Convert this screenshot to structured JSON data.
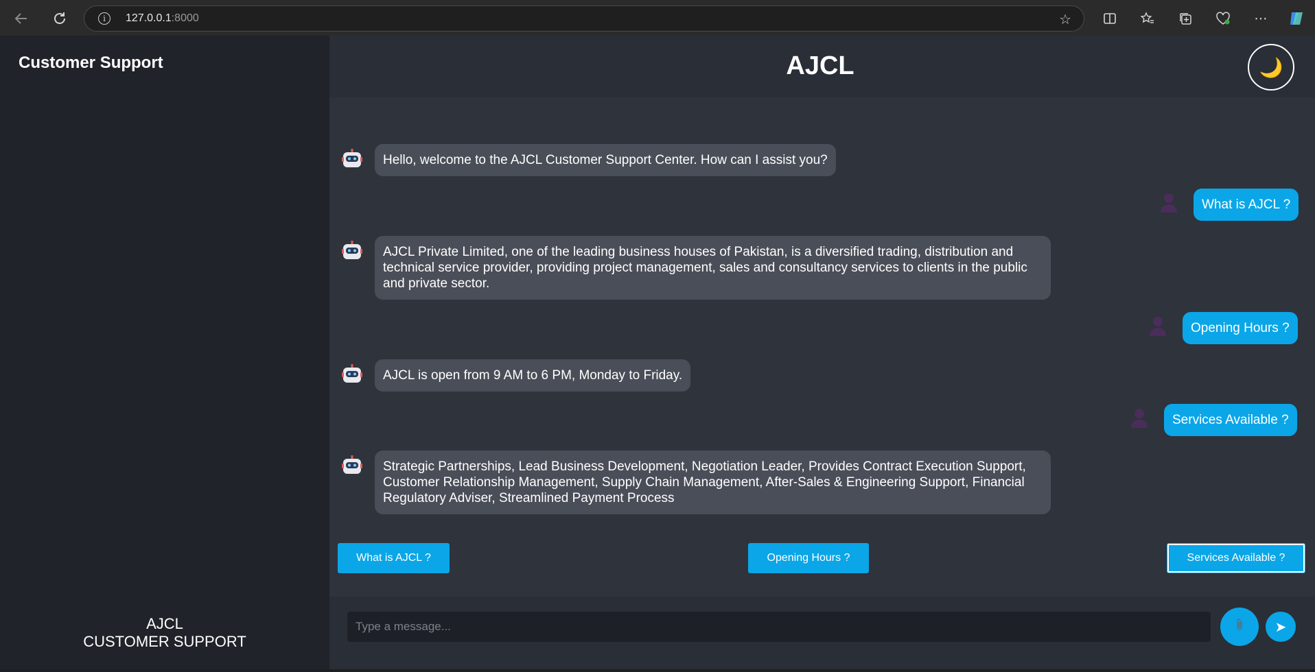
{
  "browser": {
    "url_host": "127.0.0.1",
    "url_port": ":8000"
  },
  "sidebar": {
    "title": "Customer Support",
    "footer_line1": "AJCL",
    "footer_line2": "CUSTOMER SUPPORT"
  },
  "header": {
    "title": "AJCL",
    "theme_icon": "moon-icon"
  },
  "messages": [
    {
      "sender": "bot",
      "text": "Hello, welcome to the AJCL Customer Support Center. How can I assist you?"
    },
    {
      "sender": "user",
      "text": "What is AJCL ?"
    },
    {
      "sender": "bot",
      "text": "AJCL Private Limited, one of the leading business houses of Pakistan, is a diversified trading, distribution and technical service provider, providing project management, sales and consultancy services to clients in the public and private sector."
    },
    {
      "sender": "user",
      "text": "Opening Hours ?"
    },
    {
      "sender": "bot",
      "text": "AJCL is open from 9 AM to 6 PM, Monday to Friday."
    },
    {
      "sender": "user",
      "text": "Services Available ?"
    },
    {
      "sender": "bot",
      "text": "Strategic Partnerships, Lead Business Development, Negotiation Leader, Provides Contract Execution Support, Customer Relationship Management, Supply Chain Management, After-Sales & Engineering Support, Financial Regulatory Adviser, Streamlined Payment Process"
    }
  ],
  "quick_replies": [
    "What is AJCL ?",
    "Opening Hours ?",
    "Services Available ?"
  ],
  "input": {
    "placeholder": "Type a message...",
    "value": ""
  },
  "colors": {
    "accent": "#0aa6e8",
    "bot_bubble": "#4a4e58",
    "main_bg": "#2f333c",
    "sidebar_bg": "#202329"
  }
}
